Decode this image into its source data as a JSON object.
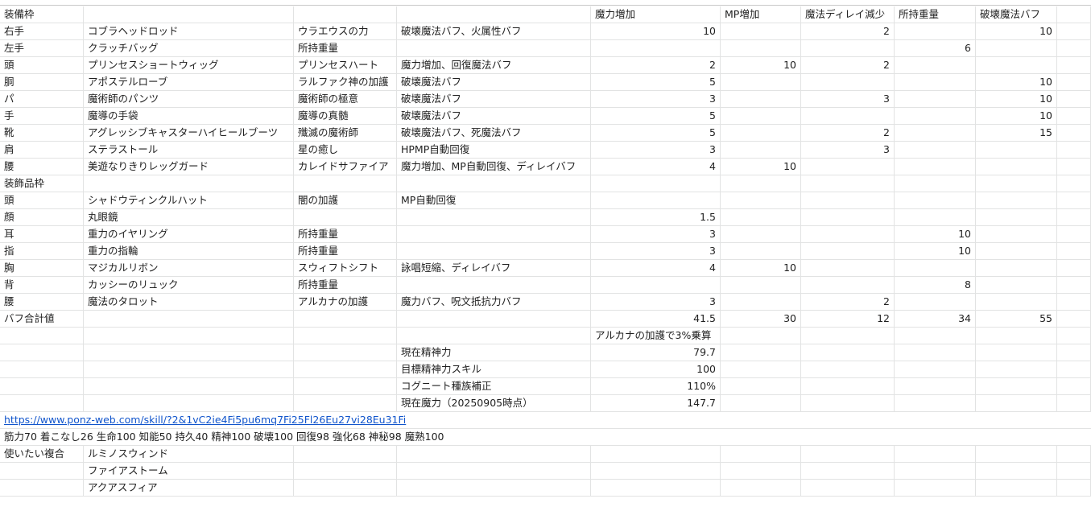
{
  "sheet": {
    "rows": [
      {
        "cells": [
          "装備枠",
          "",
          "",
          "",
          "魔力増加",
          "MP増加",
          "魔法ディレイ減少",
          "所持重量",
          "破壊魔法バフ"
        ],
        "hdr": true
      },
      {
        "cells": [
          "右手",
          "コブラヘッドロッド",
          "ウラエウスの力",
          "破壊魔法バフ、火属性バフ",
          "10",
          "",
          "2",
          "",
          "10"
        ]
      },
      {
        "cells": [
          "左手",
          "クラッチバッグ",
          "所持重量",
          "",
          "",
          "",
          "",
          "6",
          ""
        ]
      },
      {
        "cells": [
          "頭",
          "プリンセスショートウィッグ",
          "プリンセスハート",
          "魔力増加、回復魔法バフ",
          "2",
          "10",
          "2",
          "",
          ""
        ]
      },
      {
        "cells": [
          "胴",
          "アポステルローブ",
          "ラルファク神の加護",
          "破壊魔法バフ",
          "5",
          "",
          "",
          "",
          "10"
        ]
      },
      {
        "cells": [
          "パ",
          "魔術師のパンツ",
          "魔術師の極意",
          "破壊魔法バフ",
          "3",
          "",
          "3",
          "",
          "10"
        ]
      },
      {
        "cells": [
          "手",
          "魔導の手袋",
          "魔導の真髄",
          "破壊魔法バフ",
          "5",
          "",
          "",
          "",
          "10"
        ]
      },
      {
        "cells": [
          "靴",
          "アグレッシブキャスターハイヒールブーツ",
          "殲滅の魔術師",
          "破壊魔法バフ、死魔法バフ",
          "5",
          "",
          "2",
          "",
          "15"
        ]
      },
      {
        "cells": [
          "肩",
          "ステラストール",
          "星の癒し",
          "HPMP自動回復",
          "3",
          "",
          "3",
          "",
          ""
        ]
      },
      {
        "cells": [
          "腰",
          "美遊なりきりレッグガード",
          "カレイドサファイア",
          "魔力増加、MP自動回復、ディレイバフ",
          "4",
          "10",
          "",
          "",
          ""
        ]
      },
      {
        "cells": [
          "装飾品枠",
          "",
          "",
          "",
          "",
          "",
          "",
          "",
          ""
        ]
      },
      {
        "cells": [
          "頭",
          "シャドウティンクルハット",
          "闇の加護",
          "MP自動回復",
          "",
          "",
          "",
          "",
          ""
        ]
      },
      {
        "cells": [
          "顔",
          "丸眼鏡",
          "",
          "",
          "1.5",
          "",
          "",
          "",
          ""
        ]
      },
      {
        "cells": [
          "耳",
          "重力のイヤリング",
          "所持重量",
          "",
          "3",
          "",
          "",
          "10",
          ""
        ]
      },
      {
        "cells": [
          "指",
          "重力の指輪",
          "所持重量",
          "",
          "3",
          "",
          "",
          "10",
          ""
        ]
      },
      {
        "cells": [
          "胸",
          "マジカルリボン",
          "スウィフトシフト",
          "詠唱短縮、ディレイバフ",
          "4",
          "10",
          "",
          "",
          ""
        ]
      },
      {
        "cells": [
          "背",
          "カッシーのリュック",
          "所持重量",
          "",
          "",
          "",
          "",
          "8",
          ""
        ]
      },
      {
        "cells": [
          "腰",
          "魔法のタロット",
          "アルカナの加護",
          "魔力バフ、呪文抵抗力バフ",
          "3",
          "",
          "2",
          "",
          ""
        ]
      },
      {
        "cells": [
          "バフ合計値",
          "",
          "",
          "",
          "41.5",
          "30",
          "12",
          "34",
          "55"
        ]
      },
      {
        "cells": [
          "",
          "",
          "",
          "",
          "アルカナの加護で3%乗算",
          "",
          "",
          "",
          ""
        ],
        "hdr": true
      },
      {
        "cells": [
          "",
          "",
          "",
          "現在精神力",
          "79.7",
          "",
          "",
          "",
          ""
        ]
      },
      {
        "cells": [
          "",
          "",
          "",
          "目標精神力スキル",
          "100",
          "",
          "",
          "",
          ""
        ]
      },
      {
        "cells": [
          "",
          "",
          "",
          "コグニート種族補正",
          "110%",
          "",
          "",
          "",
          ""
        ]
      },
      {
        "cells": [
          "",
          "",
          "",
          "現在魔力（20250905時点）",
          "147.7",
          "",
          "",
          "",
          ""
        ]
      },
      {
        "cells": [
          "",
          "",
          "",
          "",
          "",
          "",
          "",
          "",
          ""
        ],
        "wide": "https://www.ponz-web.com/skill/?2&1vC2ie4Fi5pu6mq7Fi25Fl26Eu27vi28Eu31Fi",
        "link": true
      },
      {
        "cells": [
          "",
          "",
          "",
          "",
          "",
          "",
          "",
          "",
          ""
        ],
        "wide": "筋力70 着こなし26 生命100 知能50 持久40 精神100 破壊100 回復98 強化68 神秘98 魔熟100"
      },
      {
        "cells": [
          "使いたい複合",
          "ルミノスウィンド",
          "",
          "",
          "",
          "",
          "",
          "",
          ""
        ]
      },
      {
        "cells": [
          "",
          "ファイアストーム",
          "",
          "",
          "",
          "",
          "",
          "",
          ""
        ]
      },
      {
        "cells": [
          "",
          "アクアスフィア",
          "",
          "",
          "",
          "",
          "",
          "",
          ""
        ]
      }
    ]
  }
}
